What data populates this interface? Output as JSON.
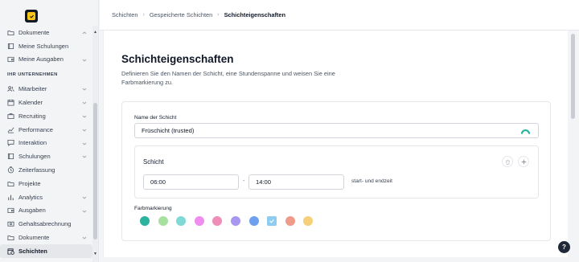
{
  "sidebar": {
    "items_top": [
      {
        "label": "Dokumente",
        "icon": "folder-icon",
        "chevron": "up"
      },
      {
        "label": "Meine Schulungen",
        "icon": "book-icon",
        "chevron": ""
      },
      {
        "label": "Meine Ausgaben",
        "icon": "wallet-icon",
        "chevron": "down"
      }
    ],
    "section_label": "IHR UNTERNEHMEN",
    "items": [
      {
        "label": "Mitarbeiter",
        "icon": "users-icon",
        "chevron": "down"
      },
      {
        "label": "Kalender",
        "icon": "calendar-icon",
        "chevron": "down"
      },
      {
        "label": "Recruiting",
        "icon": "briefcase-icon",
        "chevron": "down"
      },
      {
        "label": "Performance",
        "icon": "chart-icon",
        "chevron": "down"
      },
      {
        "label": "Interaktion",
        "icon": "chat-icon",
        "chevron": "down"
      },
      {
        "label": "Schulungen",
        "icon": "book-icon",
        "chevron": "down"
      },
      {
        "label": "Zeiterfassung",
        "icon": "clock-icon",
        "chevron": ""
      },
      {
        "label": "Projekte",
        "icon": "folder-icon",
        "chevron": ""
      },
      {
        "label": "Analytics",
        "icon": "analytics-icon",
        "chevron": "down"
      },
      {
        "label": "Ausgaben",
        "icon": "wallet-icon",
        "chevron": "down"
      },
      {
        "label": "Gehaltsabrechnung",
        "icon": "money-icon",
        "chevron": ""
      },
      {
        "label": "Dokumente",
        "icon": "folder-icon",
        "chevron": "down"
      },
      {
        "label": "Schichten",
        "icon": "shift-calendar-icon",
        "chevron": "",
        "active": true
      }
    ]
  },
  "breadcrumb": {
    "items": [
      "Schichten",
      "Gespeicherte Schichten"
    ],
    "current": "Schichteigenschaften"
  },
  "page": {
    "title": "Schichteigenschaften",
    "description": "Definieren Sie den Namen der Schicht, eine Stundenspanne und weisen Sie eine Farbmarkierung zu."
  },
  "form": {
    "name_label": "Name der Schicht",
    "name_value": "Früschicht (trusted)",
    "shift_title": "Schicht",
    "start_time": "06:00",
    "separator": "-",
    "end_time": "14:00",
    "time_hint": "start- und endzeit",
    "color_label": "Farbmarkierung",
    "colors": [
      "#2bb3a0",
      "#a8e0a0",
      "#7fd9d4",
      "#f08cf0",
      "#f08cb8",
      "#a896f0",
      "#6fa0f0",
      "#8ecdf0",
      "#f09a8a",
      "#f5cf7a"
    ],
    "selected_color": "#8ecdf0"
  },
  "help_label": "?",
  "colors": {
    "accent": "#f5c518",
    "check": "#ffffff"
  }
}
